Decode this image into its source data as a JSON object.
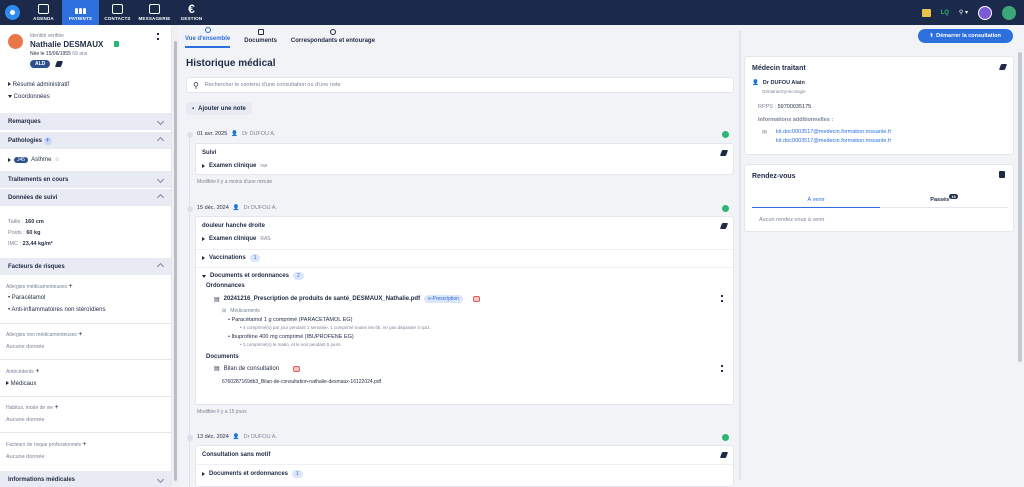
{
  "topnav": {
    "items": [
      {
        "label": "AGENDA"
      },
      {
        "label": "PATIENTS"
      },
      {
        "label": "CONTACTS"
      },
      {
        "label": "MESSAGERIE"
      },
      {
        "label": "GESTION"
      }
    ],
    "right_lq": "LQ"
  },
  "patient": {
    "identity_label": "Identité vérifiée",
    "name": "Nathalie DESMAUX",
    "dob": "Née le 15/06/1955",
    "age": "69 ans",
    "badge": "ALD"
  },
  "left": {
    "links": [
      "Résumé administratif",
      "Coordonnées"
    ],
    "sections": {
      "remarques": "Remarques",
      "pathologies": "Pathologies",
      "traitements": "Traitements en cours",
      "donnees": "Données de suivi",
      "facteurs": "Facteurs de risques",
      "infos": "Informations médicales"
    },
    "pathology": {
      "code": "J45",
      "name": "Asthme"
    },
    "donnees": {
      "taille_label": "Taille :",
      "taille": "160 cm",
      "poids_label": "Poids :",
      "poids": "60 kg",
      "imc_label": "IMC :",
      "imc": "23,44 kg/m²"
    },
    "allergies_med_label": "Allergies médicamenteuses",
    "allergies_med": [
      "Paracétamol",
      "Anti-inflammatoires non stéroïdiens"
    ],
    "allergies_nonmed_label": "Allergies non médicamenteuses",
    "allergies_nonmed_value": "Aucune donnée",
    "antecedents_label": "Antécédents",
    "antecedents_item": "Médicaux",
    "habitus_label": "Habitus, mode de vie",
    "habitus_value": "Aucune donnée",
    "pro_label": "Facteurs de risque professionnels",
    "pro_value": "Aucune donnée"
  },
  "tabs": [
    "Vue d'ensemble",
    "Documents",
    "Correspondants et entourage"
  ],
  "start_button": "Démarrer la consultation",
  "history": {
    "title": "Historique médical",
    "search_placeholder": "Rechercher le contenu d'une consultation ou d'une note",
    "add_note": "Ajouter une note"
  },
  "entries": [
    {
      "date": "01 avr. 2025",
      "doctor": "Dr DUFOU A.",
      "title": "Suivi",
      "exam_label": "Examen clinique",
      "exam_value": "ras",
      "modified": "Modifiée il y a moins d'une minute"
    },
    {
      "date": "15 déc. 2024",
      "doctor": "Dr DUFOU A.",
      "title": "douleur hanche droite",
      "exam_label": "Examen clinique",
      "exam_value": "RAS",
      "vacc_label": "Vaccinations",
      "vacc_count": "1",
      "docs_label": "Documents et ordonnances",
      "docs_count": "2",
      "ord_header": "Ordonnances",
      "ord_file": "20241216_Prescription de produits de santé_DESMAUX_Nathalie.pdf",
      "ord_tag": "e-Prescription",
      "med_label": "Médicaments",
      "meds": [
        {
          "name": "Paracétamol 1 g comprimé (PARACETAMOL EG)",
          "posology": "4 comprimé(s) par jour pendant 1 semaine, 1 comprimé toutes les 6h, ne pas dépasser 4 cp/J."
        },
        {
          "name": "Ibuprofène 400 mg comprimé (IBUPROFENE EG)",
          "posology": "1 comprimé(s) le matin, et le soir pendant 5 jours."
        }
      ],
      "doc_header": "Documents",
      "doc_name": "Bilan de consultation",
      "doc_file": "6760287169db3_Bilan-de-consultation-nathalie-desmaux-16122024.pdf",
      "modified": "Modifiée il y a 15 jours"
    },
    {
      "date": "13 déc. 2024",
      "doctor": "Dr DUFOU A.",
      "title": "Consultation sans motif",
      "docs_label": "Documents et ordonnances",
      "docs_count": "1"
    }
  ],
  "medecin": {
    "title": "Médecin traitant",
    "name": "Dr DUFOU Alain",
    "specialty": "Gériatrie/Gynécologie",
    "rpps_label": "RPPS :",
    "rpps": "59700035175",
    "info_label": "Informations additionnelles :",
    "emails": [
      "kit.doc0003517@medecin.formation.mssante.fr",
      "kit.doc0003517@medecin.formation.mssante.fr"
    ]
  },
  "rdv": {
    "title": "Rendez-vous",
    "tab_venir": "À venir",
    "tab_passes": "Passés",
    "passes_count": "18",
    "empty": "Aucun rendez-vous à venir"
  },
  "colors": {
    "nav_bg": "#1b2a4a",
    "accent": "#2d6fdc",
    "green": "#2bb673"
  }
}
